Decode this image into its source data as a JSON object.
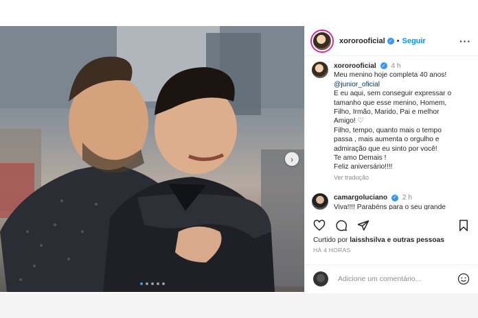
{
  "post": {
    "username": "xororooficial",
    "follow_label": "Seguir",
    "more_label": "···",
    "caption": {
      "username": "xororooficial",
      "time": "4 h",
      "lines": [
        "Meu menino hoje completa 40 anos!",
        "@junior_oficial",
        "E eu aqui, sem conseguir expressar o",
        "tamanho que esse menino, Homem,",
        "Filho, Irmão, Marido, Pai e melhor",
        "Amigo! ♡",
        "Filho, tempo, quanto mais o tempo",
        "passa , mais aumenta o orgulho e",
        "admiração que eu sinto por você!",
        "Te amo Demais !",
        "Feliz aniversário!!!!"
      ],
      "see_translation": "Ver tradução"
    },
    "reply": {
      "username": "camargoluciano",
      "time": "2 h",
      "text": "Viva!!!! Parabéns para o seu grande"
    },
    "likes": {
      "prefix": "Curtido por",
      "user": "laisshsilva",
      "suffix": "e outras pessoas"
    },
    "date": "HÁ 4 HORAS",
    "comment_placeholder": "Adicione um comentário...",
    "carousel": {
      "total": 5,
      "active": 1
    }
  },
  "icons": {
    "like": "heart-icon",
    "comment": "comment-icon",
    "share": "send-icon",
    "save": "bookmark-icon",
    "emoji": "emoji-icon",
    "next": "chevron-right-icon"
  },
  "colors": {
    "link": "#0095f6",
    "verified": "#3897f0",
    "mention": "#00376b",
    "muted": "#8e8e8e"
  }
}
